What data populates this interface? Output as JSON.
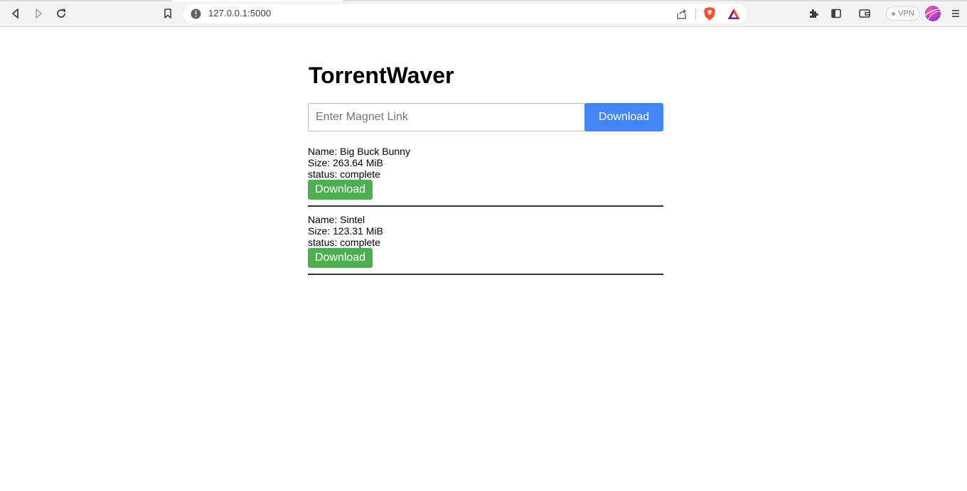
{
  "browser": {
    "url": "127.0.0.1:5000",
    "vpn_label": "VPN"
  },
  "page": {
    "title": "TorrentWaver",
    "magnet_input": {
      "placeholder": "Enter Magnet Link",
      "value": ""
    },
    "download_button_label": "Download"
  },
  "torrents": [
    {
      "name_line": "Name: Big Buck Bunny",
      "size_line": "Size: 263.64 MiB",
      "status_line": "status: complete",
      "button_label": "Download"
    },
    {
      "name_line": "Name: Sintel",
      "size_line": "Size: 123.31 MiB",
      "status_line": "status: complete",
      "button_label": "Download"
    }
  ],
  "colors": {
    "primary_button": "#4285f4",
    "download_button": "#4caf50",
    "divider": "#333333"
  }
}
